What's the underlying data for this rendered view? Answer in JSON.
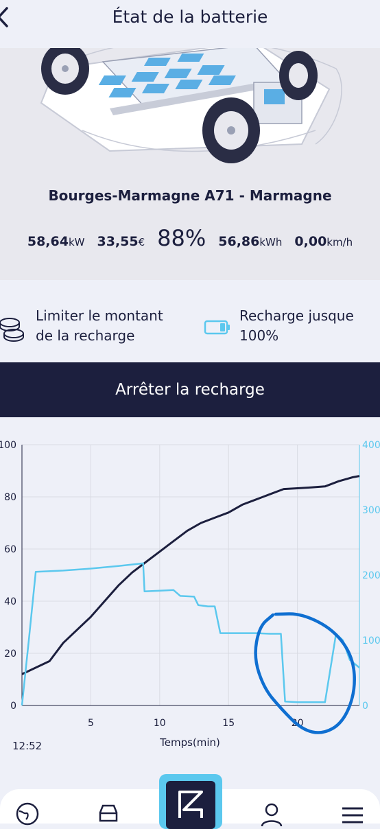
{
  "header": {
    "title": "État de la batterie"
  },
  "station": {
    "name": "Bourges-Marmagne A71 - Marmagne"
  },
  "stats": {
    "power_value": "58,64",
    "power_unit": "kW",
    "cost_value": "33,55",
    "cost_unit": "€",
    "charge_percent": "88%",
    "energy_value": "56,86",
    "energy_unit": "kWh",
    "speed_value": "0,00",
    "speed_unit": "km/h"
  },
  "options": {
    "limit_amount": {
      "line1": "Limiter le montant",
      "line2": "de la recharge"
    },
    "charge_until": {
      "line1": "Recharge jusque",
      "line2": "100%"
    }
  },
  "actions": {
    "stop_label": "Arrêter la recharge"
  },
  "chart_data": {
    "type": "line",
    "xlabel": "Temps(min)",
    "start_time": "12:52",
    "xlim": [
      0,
      24.5
    ],
    "x_ticks": [
      "5",
      "10",
      "15",
      "20"
    ],
    "ylim_left": [
      0,
      100
    ],
    "ylim_right": [
      0,
      400
    ],
    "y_ticks_left": [
      "0",
      "20",
      "40",
      "60",
      "80",
      "100"
    ],
    "y_ticks_right": [
      "0",
      "100",
      "200",
      "300",
      "400"
    ],
    "grid": true,
    "series": [
      {
        "color": "#1c1f3e",
        "axis": "left",
        "points": [
          [
            0,
            12
          ],
          [
            1,
            14.5
          ],
          [
            2,
            17
          ],
          [
            3,
            24
          ],
          [
            4,
            29
          ],
          [
            5,
            34
          ],
          [
            6,
            40
          ],
          [
            7,
            46
          ],
          [
            8,
            51
          ],
          [
            9,
            55
          ],
          [
            10,
            59
          ],
          [
            11,
            63
          ],
          [
            12,
            67
          ],
          [
            13,
            70
          ],
          [
            14,
            72
          ],
          [
            15,
            74
          ],
          [
            16,
            77
          ],
          [
            17,
            79
          ],
          [
            18,
            81
          ],
          [
            19,
            83
          ],
          [
            20,
            83.3
          ],
          [
            21,
            83.6
          ],
          [
            22,
            84
          ],
          [
            23,
            86
          ],
          [
            24,
            87.5
          ],
          [
            24.5,
            88
          ]
        ]
      },
      {
        "color": "#5bc8ee",
        "axis": "right",
        "points": [
          [
            0,
            0
          ],
          [
            0.5,
            100
          ],
          [
            1,
            205
          ],
          [
            3,
            207
          ],
          [
            5,
            210
          ],
          [
            7,
            214
          ],
          [
            8.8,
            218
          ],
          [
            8.9,
            175
          ],
          [
            10,
            176
          ],
          [
            11,
            177
          ],
          [
            11.5,
            168
          ],
          [
            12.5,
            167
          ],
          [
            12.8,
            154
          ],
          [
            13.5,
            152
          ],
          [
            14,
            152
          ],
          [
            14.4,
            111
          ],
          [
            16,
            111
          ],
          [
            17,
            111
          ],
          [
            18,
            110
          ],
          [
            18.8,
            110
          ],
          [
            19.1,
            6
          ],
          [
            20,
            5
          ],
          [
            21,
            5
          ],
          [
            22,
            5
          ],
          [
            22.5,
            70
          ],
          [
            22.8,
            110
          ],
          [
            23.3,
            100
          ],
          [
            23.8,
            70
          ],
          [
            24.5,
            58
          ]
        ]
      }
    ]
  },
  "annotation": {
    "color": "#0f6fd1"
  },
  "nav": {
    "items": [
      "map-icon",
      "car-icon",
      "charging-icon",
      "profile-icon",
      "menu-icon"
    ]
  }
}
